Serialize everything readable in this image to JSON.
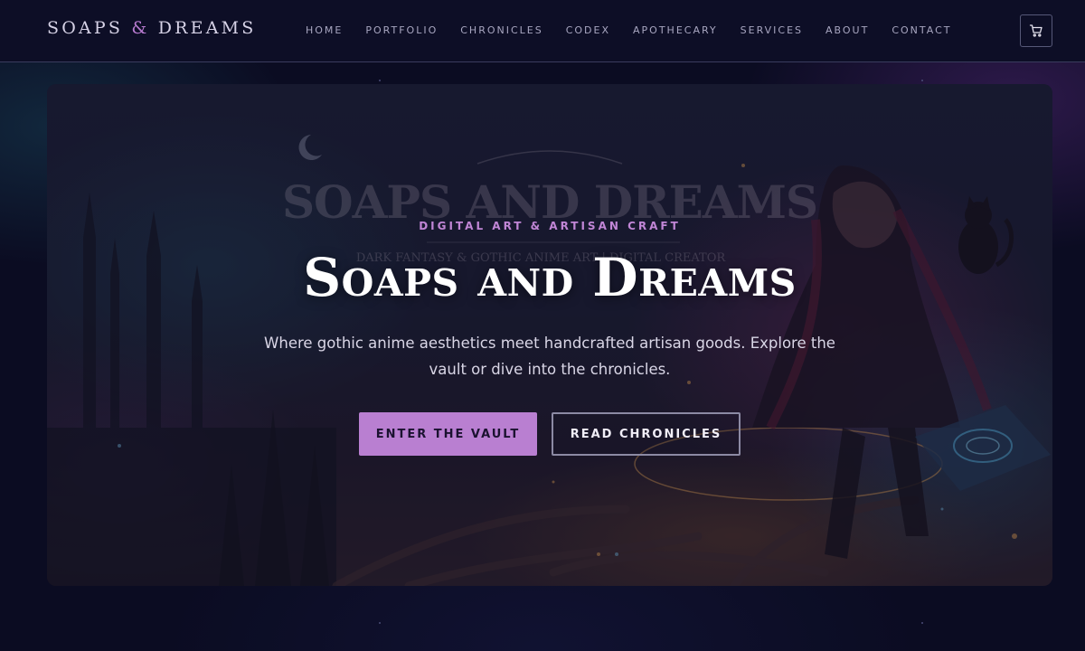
{
  "brand": {
    "logo_part1": "SOAPS ",
    "logo_amp": "&",
    "logo_part2": " DREAMS"
  },
  "nav": {
    "items": [
      {
        "label": "HOME"
      },
      {
        "label": "PORTFOLIO"
      },
      {
        "label": "CHRONICLES"
      },
      {
        "label": "CODEX"
      },
      {
        "label": "APOTHECARY"
      },
      {
        "label": "SERVICES"
      },
      {
        "label": "ABOUT"
      },
      {
        "label": "CONTACT"
      }
    ],
    "cart_icon": "shopping-cart-icon"
  },
  "hero": {
    "eyebrow": "DIGITAL ART & ARTISAN CRAFT",
    "title": "Soaps and Dreams",
    "subtitle": "Where gothic anime aesthetics meet handcrafted artisan goods. Explore the vault or dive into the chronicles.",
    "primary_cta": "ENTER THE VAULT",
    "secondary_cta": "READ CHRONICLES",
    "background_logo_line1": "SOAPS AND DREAMS",
    "background_logo_line2": "DARK FANTASY & GOTHIC ANIME ART | DIGITAL CREATOR"
  },
  "colors": {
    "background": "#0b0c22",
    "accent": "#b97fd1",
    "eyebrow": "#c186d6",
    "header_border": "#3a3c5e"
  }
}
